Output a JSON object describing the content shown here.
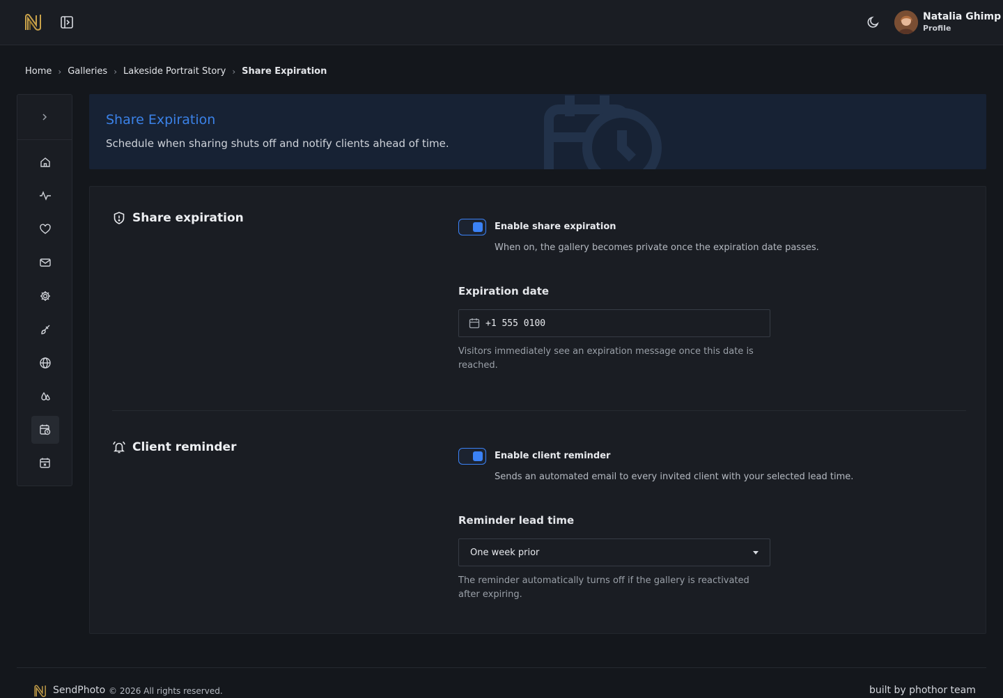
{
  "header": {
    "user_name": "Natalia Ghimp",
    "user_role": "Profile",
    "logo_icon": "n-logo-icon",
    "sidebar_toggle_icon": "panel-toggle-icon",
    "theme_icon": "moon-icon"
  },
  "breadcrumb": [
    "Home",
    "Galleries",
    "Lakeside Portrait Story",
    "Share Expiration"
  ],
  "sidebar": {
    "items": [
      {
        "icon": "home-icon"
      },
      {
        "icon": "activity-icon"
      },
      {
        "icon": "heart-icon"
      },
      {
        "icon": "mail-icon"
      },
      {
        "icon": "gear-icon"
      },
      {
        "icon": "brush-icon"
      },
      {
        "icon": "globe-icon"
      },
      {
        "icon": "droplets-icon"
      },
      {
        "icon": "calendar-clock-icon",
        "active": true
      },
      {
        "icon": "calendar-x-icon"
      }
    ]
  },
  "hero": {
    "title": "Share Expiration",
    "subtitle": "Schedule when sharing shuts off and notify clients ahead of time."
  },
  "share_expiration": {
    "heading": "Share expiration",
    "toggle_label": "Enable share expiration",
    "toggle_on": true,
    "toggle_desc": "When on, the gallery becomes private once the expiration date passes.",
    "date_label": "Expiration date",
    "date_value": "+1 555 0100",
    "date_help": "Visitors immediately see an expiration message once this date is reached."
  },
  "client_reminder": {
    "heading": "Client reminder",
    "toggle_label": "Enable client reminder",
    "toggle_on": true,
    "toggle_desc": "Sends an automated email to every invited client with your selected lead time.",
    "lead_label": "Reminder lead time",
    "lead_value": "One week prior",
    "lead_help": "The reminder automatically turns off if the gallery is reactivated after expiring."
  },
  "footer": {
    "brand": "SendPhoto",
    "copyright": "© 2026 All rights reserved.",
    "built_by": "built by phothor team"
  },
  "colors": {
    "accent": "#3b82f6",
    "background": "#14171c",
    "surface": "#1a1d23",
    "hero_bg": "#172234"
  }
}
